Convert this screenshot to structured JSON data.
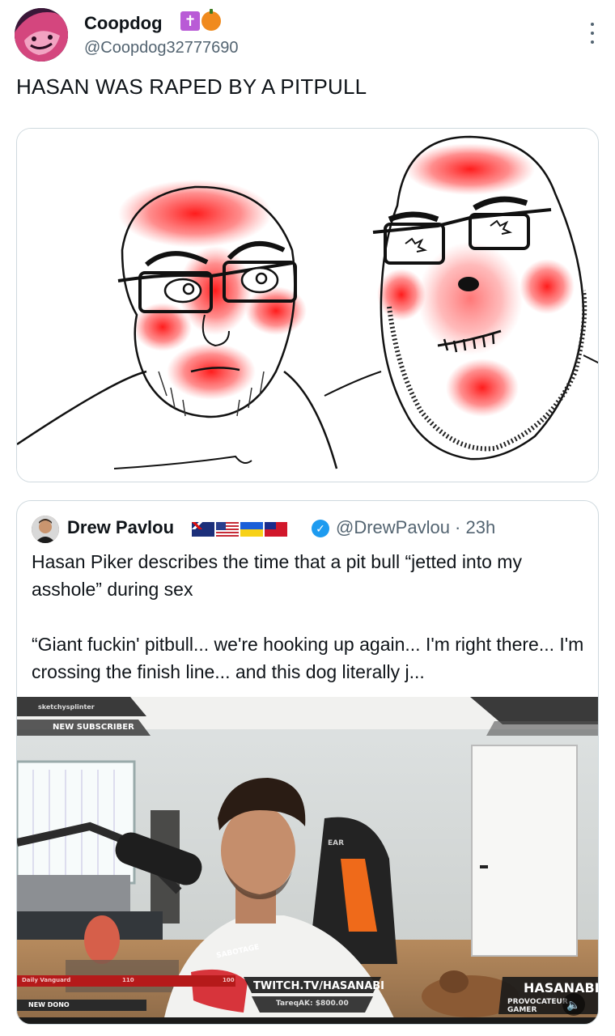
{
  "tweet": {
    "author_name": "Coopdog",
    "author_handle": "@Coopdog32777690",
    "text": "HASAN WAS RAPED BY A PITPULL",
    "badges": [
      "cross-badge",
      "pumpkin-badge"
    ]
  },
  "quote": {
    "author_name": "Drew Pavlou",
    "handle_time": "@DrewPavlou · 23h",
    "flags": [
      "australia-flag",
      "usa-flag",
      "ukraine-flag",
      "taiwan-flag"
    ],
    "text": "Hasan Piker describes the time that a pit bull “jetted into my asshole” during sex\n\n“Giant fuckin' pitbull... we're hooking up again... I'm right there... I'm crossing the finish line... and this dog literally j..."
  },
  "stream_overlay": {
    "streamer_tag": "sketchysplinter",
    "new_subscriber": "NEW SUBSCRIBER",
    "daily_label": "Daily Vanguard",
    "bar_left": "110",
    "bar_right": "100",
    "new_donor": "NEW DONO",
    "twitch_url": "TWITCH.TV/HASANABI",
    "donation": "TareqAK: $800.00",
    "shirt_text": "SABOTAGE",
    "chair_text": "EAR",
    "logo_main": "HASANABI",
    "logo_sub": "PROVOCATEUR GAMER"
  },
  "colors": {
    "text_primary": "#0f1419",
    "text_secondary": "#536471",
    "border": "#cfd9de",
    "verified": "#1d9bf0",
    "blush": "#ff1a1a"
  }
}
